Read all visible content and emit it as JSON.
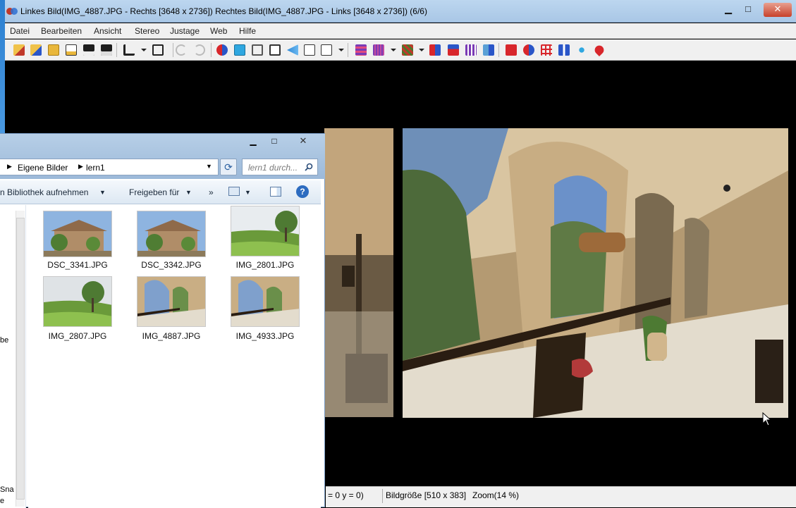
{
  "app": {
    "title": "Linkes Bild(IMG_4887.JPG - Rechts [3648 x 2736]) Rechtes Bild(IMG_4887.JPG - Links [3648 x 2736])  (6/6)",
    "window_controls": {
      "min": "▁",
      "max": "□",
      "close": "✕"
    }
  },
  "menu": [
    "Datei",
    "Bearbeiten",
    "Ansicht",
    "Stereo",
    "Justage",
    "Web",
    "Hilfe"
  ],
  "toolbar": {
    "icons": [
      "open-left-icon",
      "open-right-icon",
      "open-folder-icon",
      "open-stereo-icon",
      "save-icon",
      "save-all-icon",
      "crop-icon",
      "align-icon",
      "undo-icon",
      "redo-icon",
      "swap-icon",
      "fit-window-icon",
      "frame-icon",
      "fullscreen-icon",
      "prev-icon",
      "fit-icon",
      "zoom-100-icon",
      "anaglyph-icon",
      "interlace-icon",
      "pattern-icon",
      "side-by-side-icon",
      "over-under-icon",
      "columns-icon",
      "mirror-icon",
      "red-cyan-icon",
      "auto-align-icon",
      "grid-icon",
      "split-icon",
      "snow-icon",
      "pin-icon"
    ],
    "colors": {
      "red": "#d8262b",
      "blue": "#2a56c8",
      "purple": "#7a3ab5"
    }
  },
  "status": {
    "coords": "= 0 y = 0)",
    "image_size": "Bildgröße [510 x 383]",
    "zoom": "Zoom(14 %)"
  },
  "explorer": {
    "breadcrumb": [
      "Eigene Bilder",
      "lern1"
    ],
    "search_placeholder": "lern1 durch...",
    "commands": {
      "library": "n Bibliothek aufnehmen",
      "share": "Freigeben für",
      "more": "»"
    },
    "nav_fragments": [
      "be",
      "Sna",
      "e"
    ],
    "files": [
      {
        "name": "DSC_3341.JPG",
        "kind": "house"
      },
      {
        "name": "DSC_3342.JPG",
        "kind": "house"
      },
      {
        "name": "IMG_2801.JPG",
        "kind": "landscape"
      },
      {
        "name": "IMG_2807.JPG",
        "kind": "landscape"
      },
      {
        "name": "IMG_4887.JPG",
        "kind": "arcade"
      },
      {
        "name": "IMG_4933.JPG",
        "kind": "arcade"
      }
    ]
  }
}
